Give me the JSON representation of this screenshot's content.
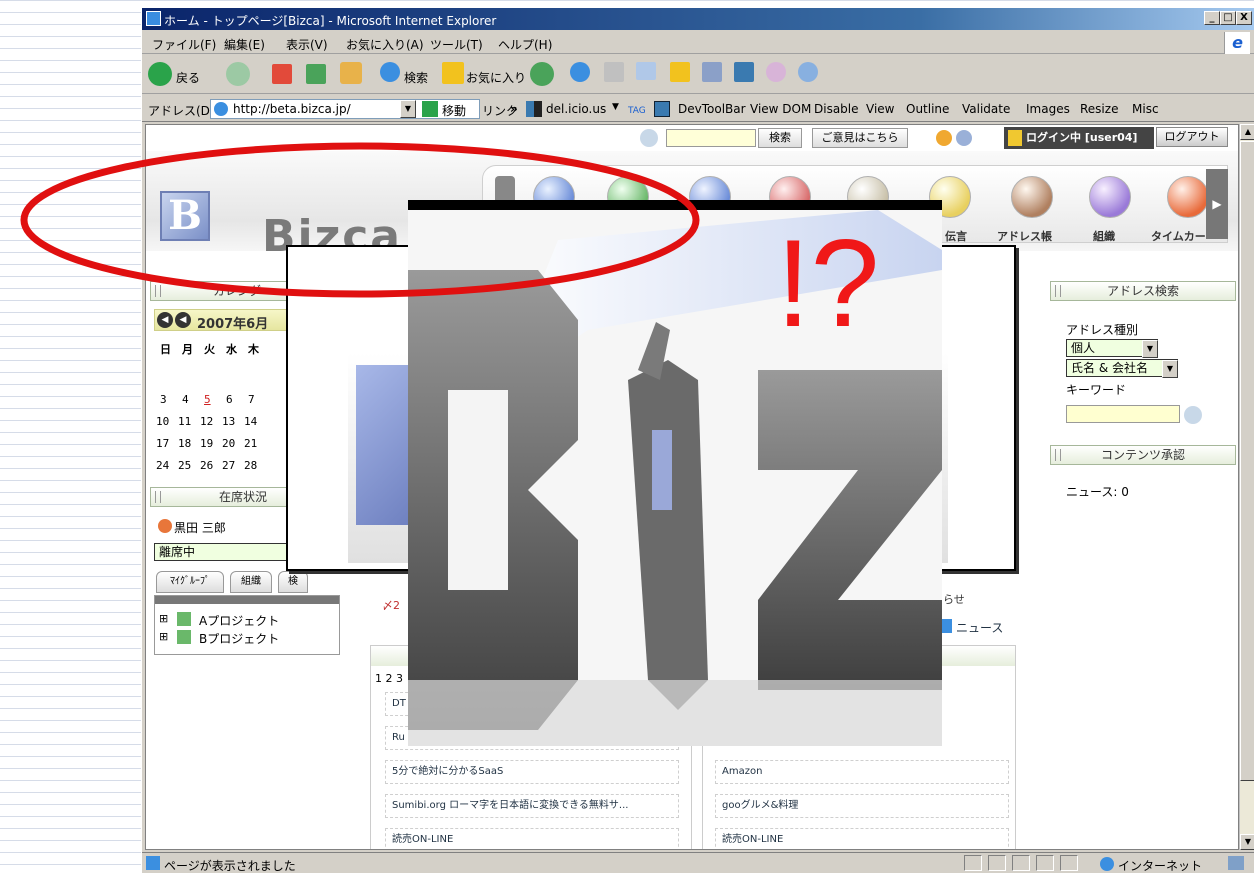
{
  "window": {
    "title": "ホーム - トップページ[Bizca] - Microsoft Internet Explorer",
    "min": "_",
    "max": "□",
    "close": "X"
  },
  "menu": [
    "ファイル(F)",
    "編集(E)",
    "表示(V)",
    "お気に入り(A)",
    "ツール(T)",
    "ヘルプ(H)"
  ],
  "toolbar": {
    "back": "戻る",
    "search": "検索",
    "favorites": "お気に入り"
  },
  "addressbar": {
    "label": "アドレス(D)",
    "url": "http://beta.bizca.jp/",
    "go": "移動",
    "links": "リンク",
    "links_more": "»",
    "delicious": "del.icio.us",
    "tag": "TAG",
    "links_items": [
      "DevToolBar",
      "View DOM",
      "Disable",
      "View",
      "Outline",
      "Validate",
      "Images",
      "Resize",
      "Misc"
    ]
  },
  "page_top": {
    "search_button": "検索",
    "feedback_button": "ご意見はこちら",
    "login_status": "ログイン中 [user04]",
    "logout_button": "ログアウト"
  },
  "logo": {
    "mark": "B",
    "word": "Bizca"
  },
  "nav": {
    "labels": [
      "伝言",
      "アドレス帳",
      "組織",
      "タイムカー"
    ],
    "next": "▶"
  },
  "calendar": {
    "title": "カレンダー",
    "month": "2007年6月",
    "weekdays": [
      "日",
      "月",
      "火",
      "水",
      "木"
    ],
    "weeks": [
      [
        "3",
        "4",
        "5",
        "6",
        "7"
      ],
      [
        "10",
        "11",
        "12",
        "13",
        "14"
      ],
      [
        "17",
        "18",
        "19",
        "20",
        "21"
      ],
      [
        "24",
        "25",
        "26",
        "27",
        "28"
      ]
    ]
  },
  "presence": {
    "title": "在席状況",
    "user": "黒田 三郎",
    "status": "離席中",
    "tabs": [
      "ﾏｲｸﾞﾙｰﾌﾟ",
      "組織",
      "検"
    ],
    "groups": [
      "Aプロジェクト",
      "Bプロジェクト"
    ],
    "expand": "⊞"
  },
  "address_search": {
    "title": "アドレス検索",
    "type_label": "アドレス種別",
    "type_value": "個人",
    "field_value": "氏名 & 会社名",
    "keyword_label": "キーワード"
  },
  "content_approval": {
    "title": "コンテンツ承認",
    "news": "ニュース: 0"
  },
  "center": {
    "notice_partial": "知らせ",
    "news_link": "ニュース",
    "pager": "1 2 3",
    "mark_prefix": "〆2",
    "left_links": [
      "DT",
      "Ru",
      "5分で絶対に分かるSaaS",
      "Sumibi.org ローマ字を日本語に変換できる無料サ...",
      "読売ON-LINE"
    ],
    "right_links": [
      "Amazon",
      "gooグルメ&料理",
      "読売ON-LINE"
    ]
  },
  "status": {
    "text": "ページが表示されました",
    "zone": "インターネット"
  },
  "overlay": {
    "exclaim": "!?"
  }
}
